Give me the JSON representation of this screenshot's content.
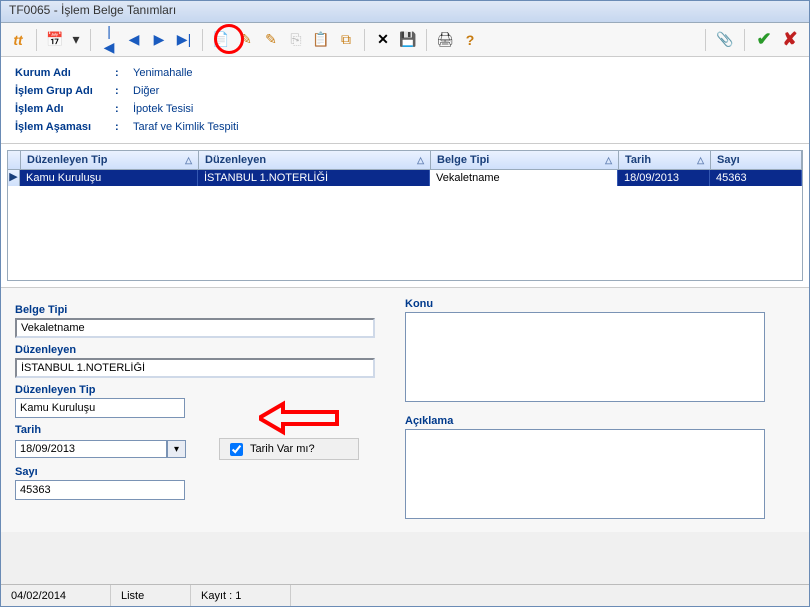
{
  "window": {
    "title": "TF0065 - İşlem Belge Tanımları"
  },
  "info": {
    "kurum_label": "Kurum Adı",
    "kurum_value": "Yenimahalle",
    "grup_label": "İşlem Grup Adı",
    "grup_value": "Diğer",
    "islem_label": "İşlem Adı",
    "islem_value": "İpotek Tesisi",
    "asama_label": "İşlem Aşaması",
    "asama_value": "Taraf ve Kimlik Tespiti",
    "sep": ":"
  },
  "grid": {
    "headers": {
      "duzenleyen_tip": "Düzenleyen Tip",
      "duzenleyen": "Düzenleyen",
      "belge_tipi": "Belge Tipi",
      "tarih": "Tarih",
      "sayi": "Sayı"
    },
    "row": {
      "duzenleyen_tip": "Kamu Kuruluşu",
      "duzenleyen": "İSTANBUL 1.NOTERLİĞİ",
      "belge_tipi": "Vekaletname",
      "tarih": "18/09/2013",
      "sayi": "45363"
    }
  },
  "form": {
    "belge_tipi_label": "Belge Tipi",
    "belge_tipi_value": "Vekaletname",
    "duzenleyen_label": "Düzenleyen",
    "duzenleyen_value": "İSTANBUL 1.NOTERLİĞİ",
    "duzenleyen_tip_label": "Düzenleyen Tip",
    "duzenleyen_tip_value": "Kamu Kuruluşu",
    "tarih_label": "Tarih",
    "tarih_value": "18/09/2013",
    "tarih_var_label": "Tarih Var mı?",
    "sayi_label": "Sayı",
    "sayi_value": "45363",
    "konu_label": "Konu",
    "aciklama_label": "Açıklama"
  },
  "status": {
    "date": "04/02/2014",
    "liste": "Liste",
    "kayit": "Kayıt : 1"
  },
  "icons": {
    "logo": "tt",
    "calendar": "📅",
    "first": "|◀",
    "prev": "◀",
    "next": "▶",
    "last": "▶|",
    "new": "📄",
    "edit1": "✎",
    "edit2": "✎",
    "copy": "⎘",
    "paste": "📋",
    "window": "⧉",
    "delete": "✕",
    "save": "💾",
    "print": "🖨",
    "help": "?",
    "attach": "📎",
    "ok": "✔",
    "cancel": "✘",
    "dropdown": "▾"
  }
}
